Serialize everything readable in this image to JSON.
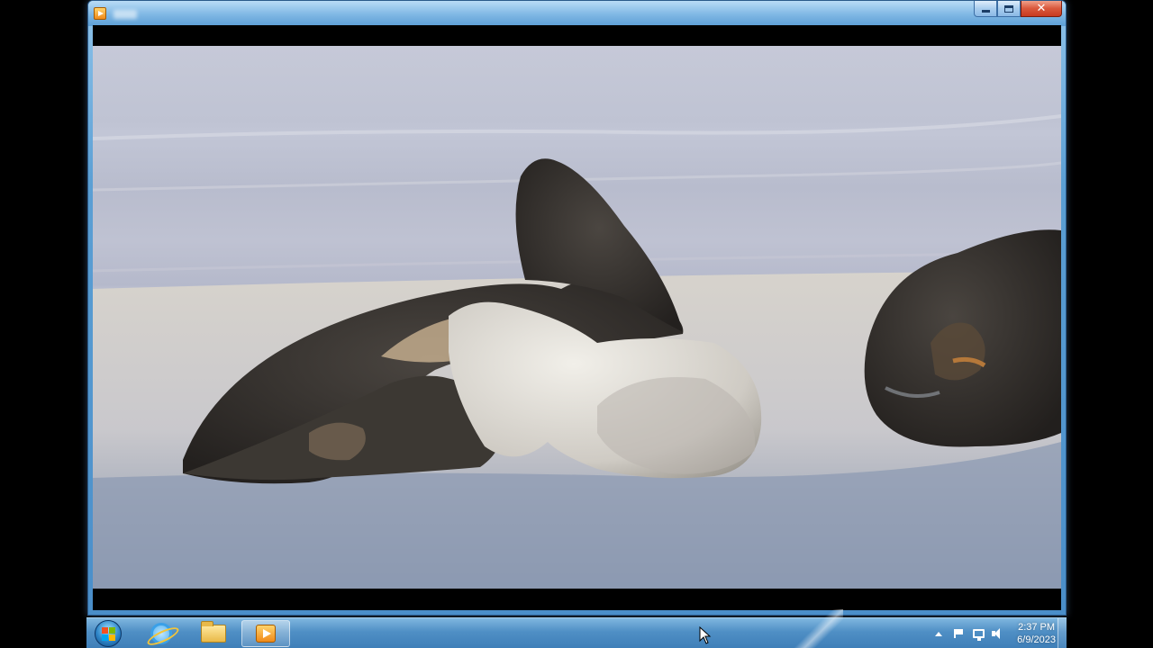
{
  "window": {
    "app": "Windows Media Player",
    "controls": {
      "minimize_icon": "minimize-icon",
      "maximize_icon": "maximize-icon",
      "close_label": "✕"
    }
  },
  "video": {
    "scene": "video-frame"
  },
  "taskbar": {
    "start_icon": "windows-start-orb",
    "pinned": [
      {
        "name": "internet-explorer-icon",
        "active": false
      },
      {
        "name": "windows-explorer-icon",
        "active": false
      },
      {
        "name": "media-player-icon",
        "active": true
      }
    ],
    "tray": {
      "time": "2:37 PM",
      "date": "6/9/2023"
    }
  },
  "colors": {
    "taskbar": "#4f8fc5",
    "titlebar": "#7fb7e4",
    "close_button": "#d9583c"
  }
}
